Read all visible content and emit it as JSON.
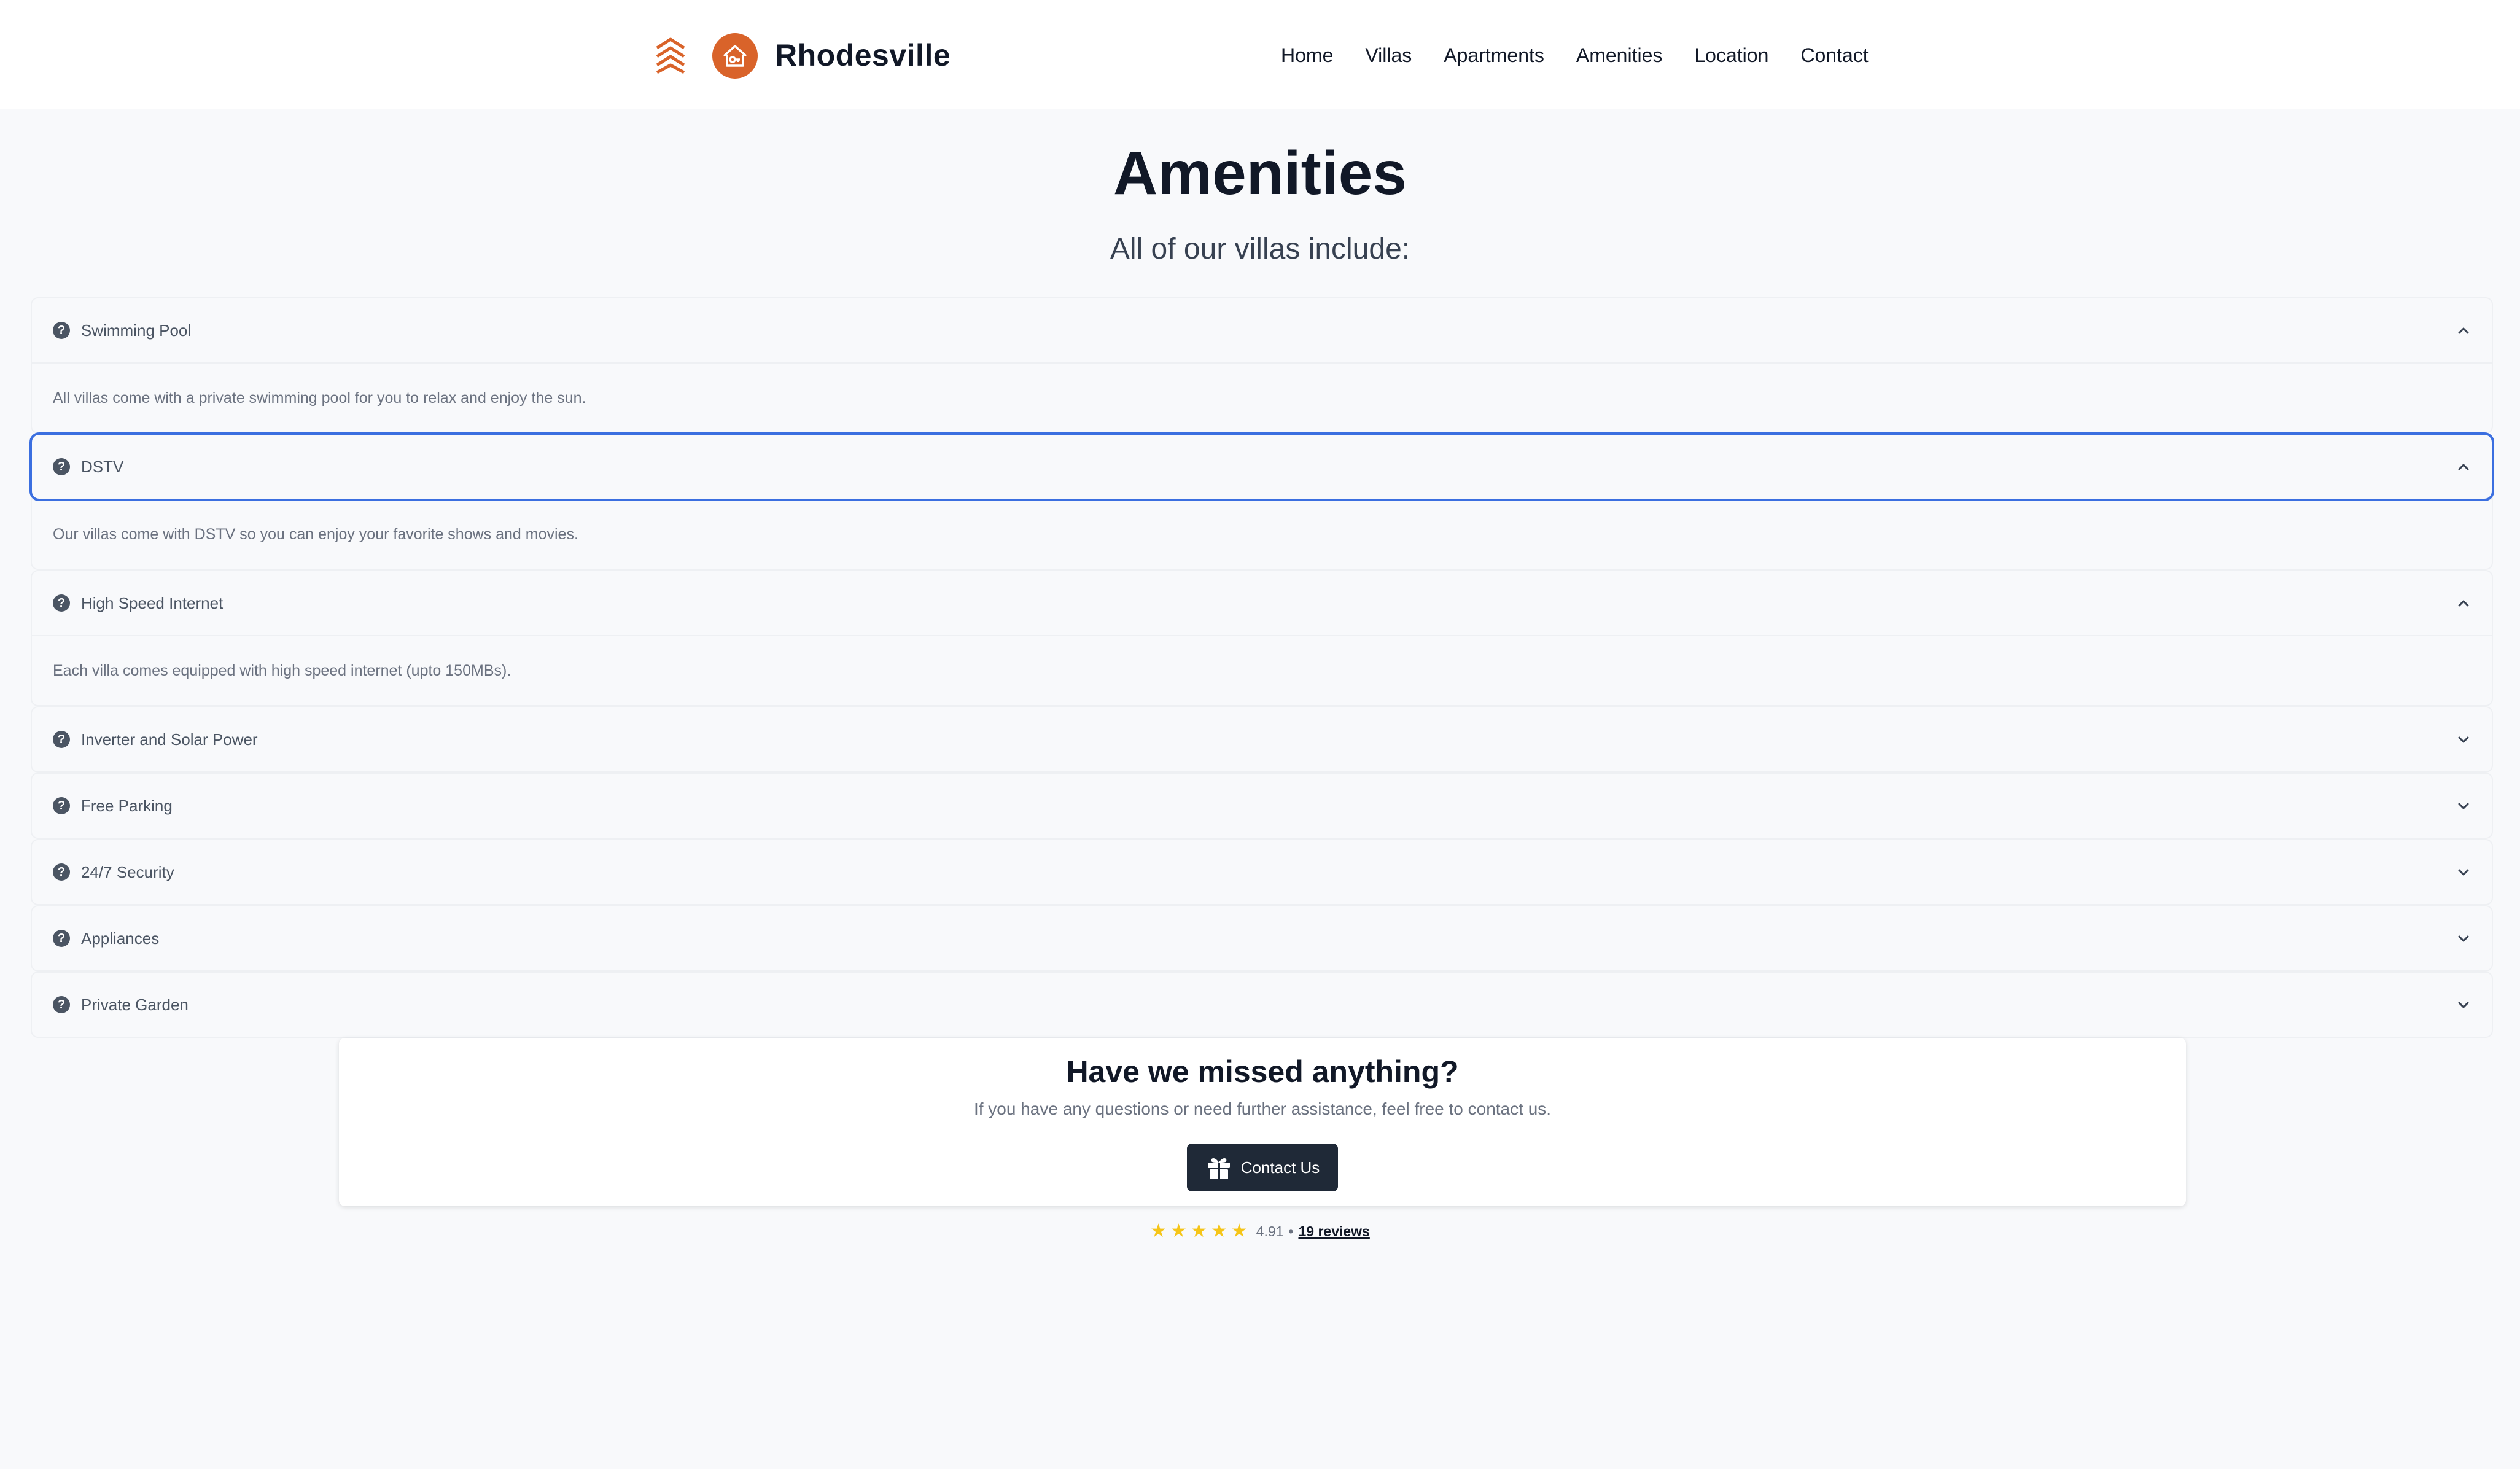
{
  "brand": {
    "name": "Rhodesville",
    "accent": "#d9632a"
  },
  "nav": [
    "Home",
    "Villas",
    "Apartments",
    "Amenities",
    "Location",
    "Contact"
  ],
  "page": {
    "title": "Amenities",
    "subtitle": "All of our villas include:"
  },
  "amenities": [
    {
      "label": "Swimming Pool",
      "expanded": true,
      "body": "All villas come with a private swimming pool for you to relax and enjoy the sun."
    },
    {
      "label": "DSTV",
      "expanded": true,
      "focused": true,
      "body": "Our villas come with DSTV so you can enjoy your favorite shows and movies."
    },
    {
      "label": "High Speed Internet",
      "expanded": true,
      "body": "Each villa comes equipped with high speed internet (upto 150MBs)."
    },
    {
      "label": "Inverter and Solar Power",
      "expanded": false
    },
    {
      "label": "Free Parking",
      "expanded": false
    },
    {
      "label": "24/7 Security",
      "expanded": false
    },
    {
      "label": "Appliances",
      "expanded": false
    },
    {
      "label": "Private Garden",
      "expanded": false
    }
  ],
  "contact_card": {
    "title": "Have we missed anything?",
    "text": "If you have any questions or need further assistance, feel free to contact us.",
    "button_label": "Contact Us",
    "button_icon": "gift-icon"
  },
  "rating": {
    "value": "4.91",
    "separator": "•",
    "reviews_label": "19 reviews",
    "stars": 5
  }
}
